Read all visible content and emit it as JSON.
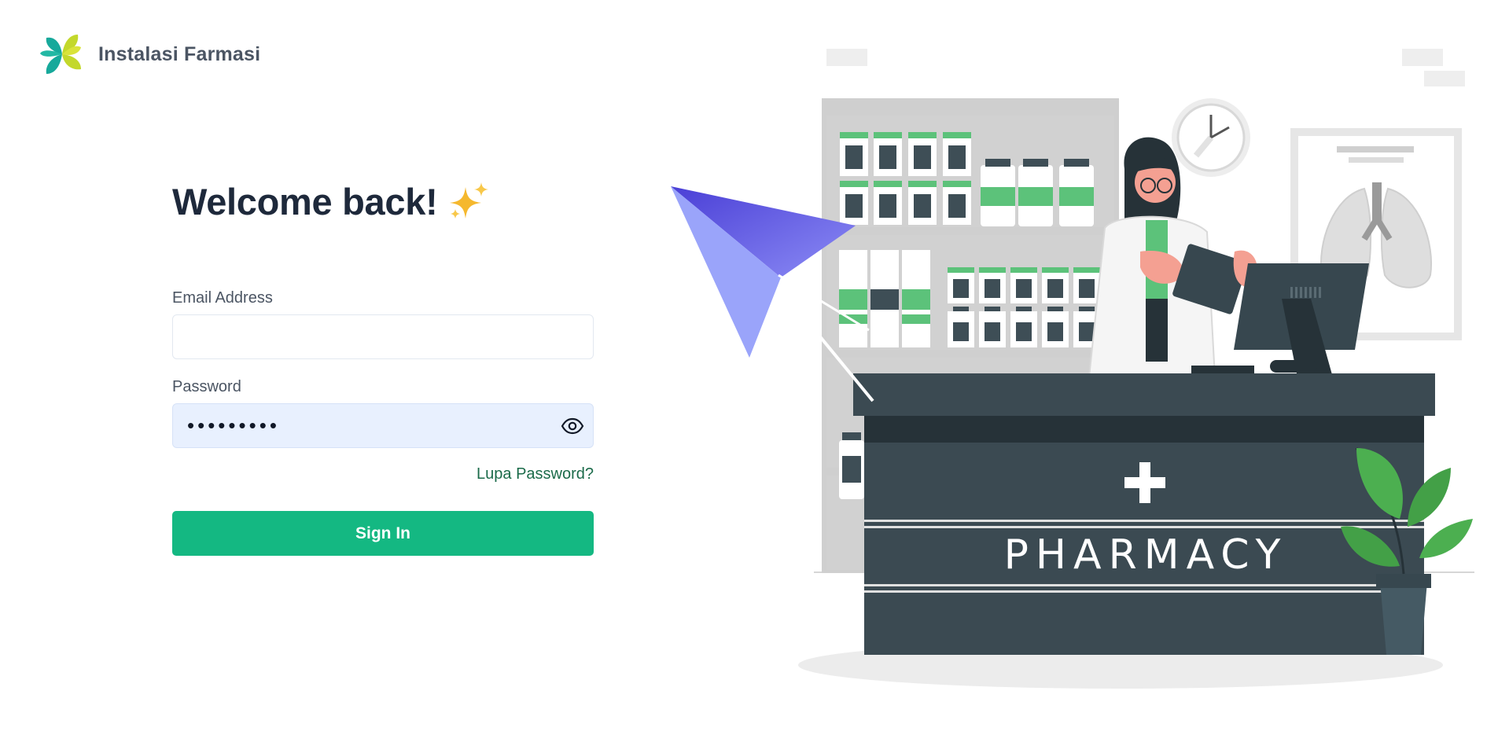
{
  "brand": {
    "name": "Instalasi Farmasi",
    "logo_icon": "kemenkes-leaf-logo-icon"
  },
  "login": {
    "title": "Welcome back!",
    "title_icon": "sparkles-icon",
    "email_label": "Email Address",
    "email_value": "",
    "password_label": "Password",
    "password_value": "•••••••••",
    "show_password_icon": "eye-icon",
    "forgot_link": "Lupa Password?",
    "submit_label": "Sign In"
  },
  "illustration": {
    "sign_text": "PHARMACY",
    "icons": [
      "paper-plane-icon",
      "wall-clock-icon",
      "medical-cross-icon",
      "plant-icon",
      "lungs-xray-icon",
      "computer-monitor-icon"
    ]
  },
  "colors": {
    "primary": "#14b882",
    "link": "#1b6b4a",
    "heading": "#1e293b",
    "counter": "#3b4a52",
    "password_fill": "#e8f0fe"
  }
}
